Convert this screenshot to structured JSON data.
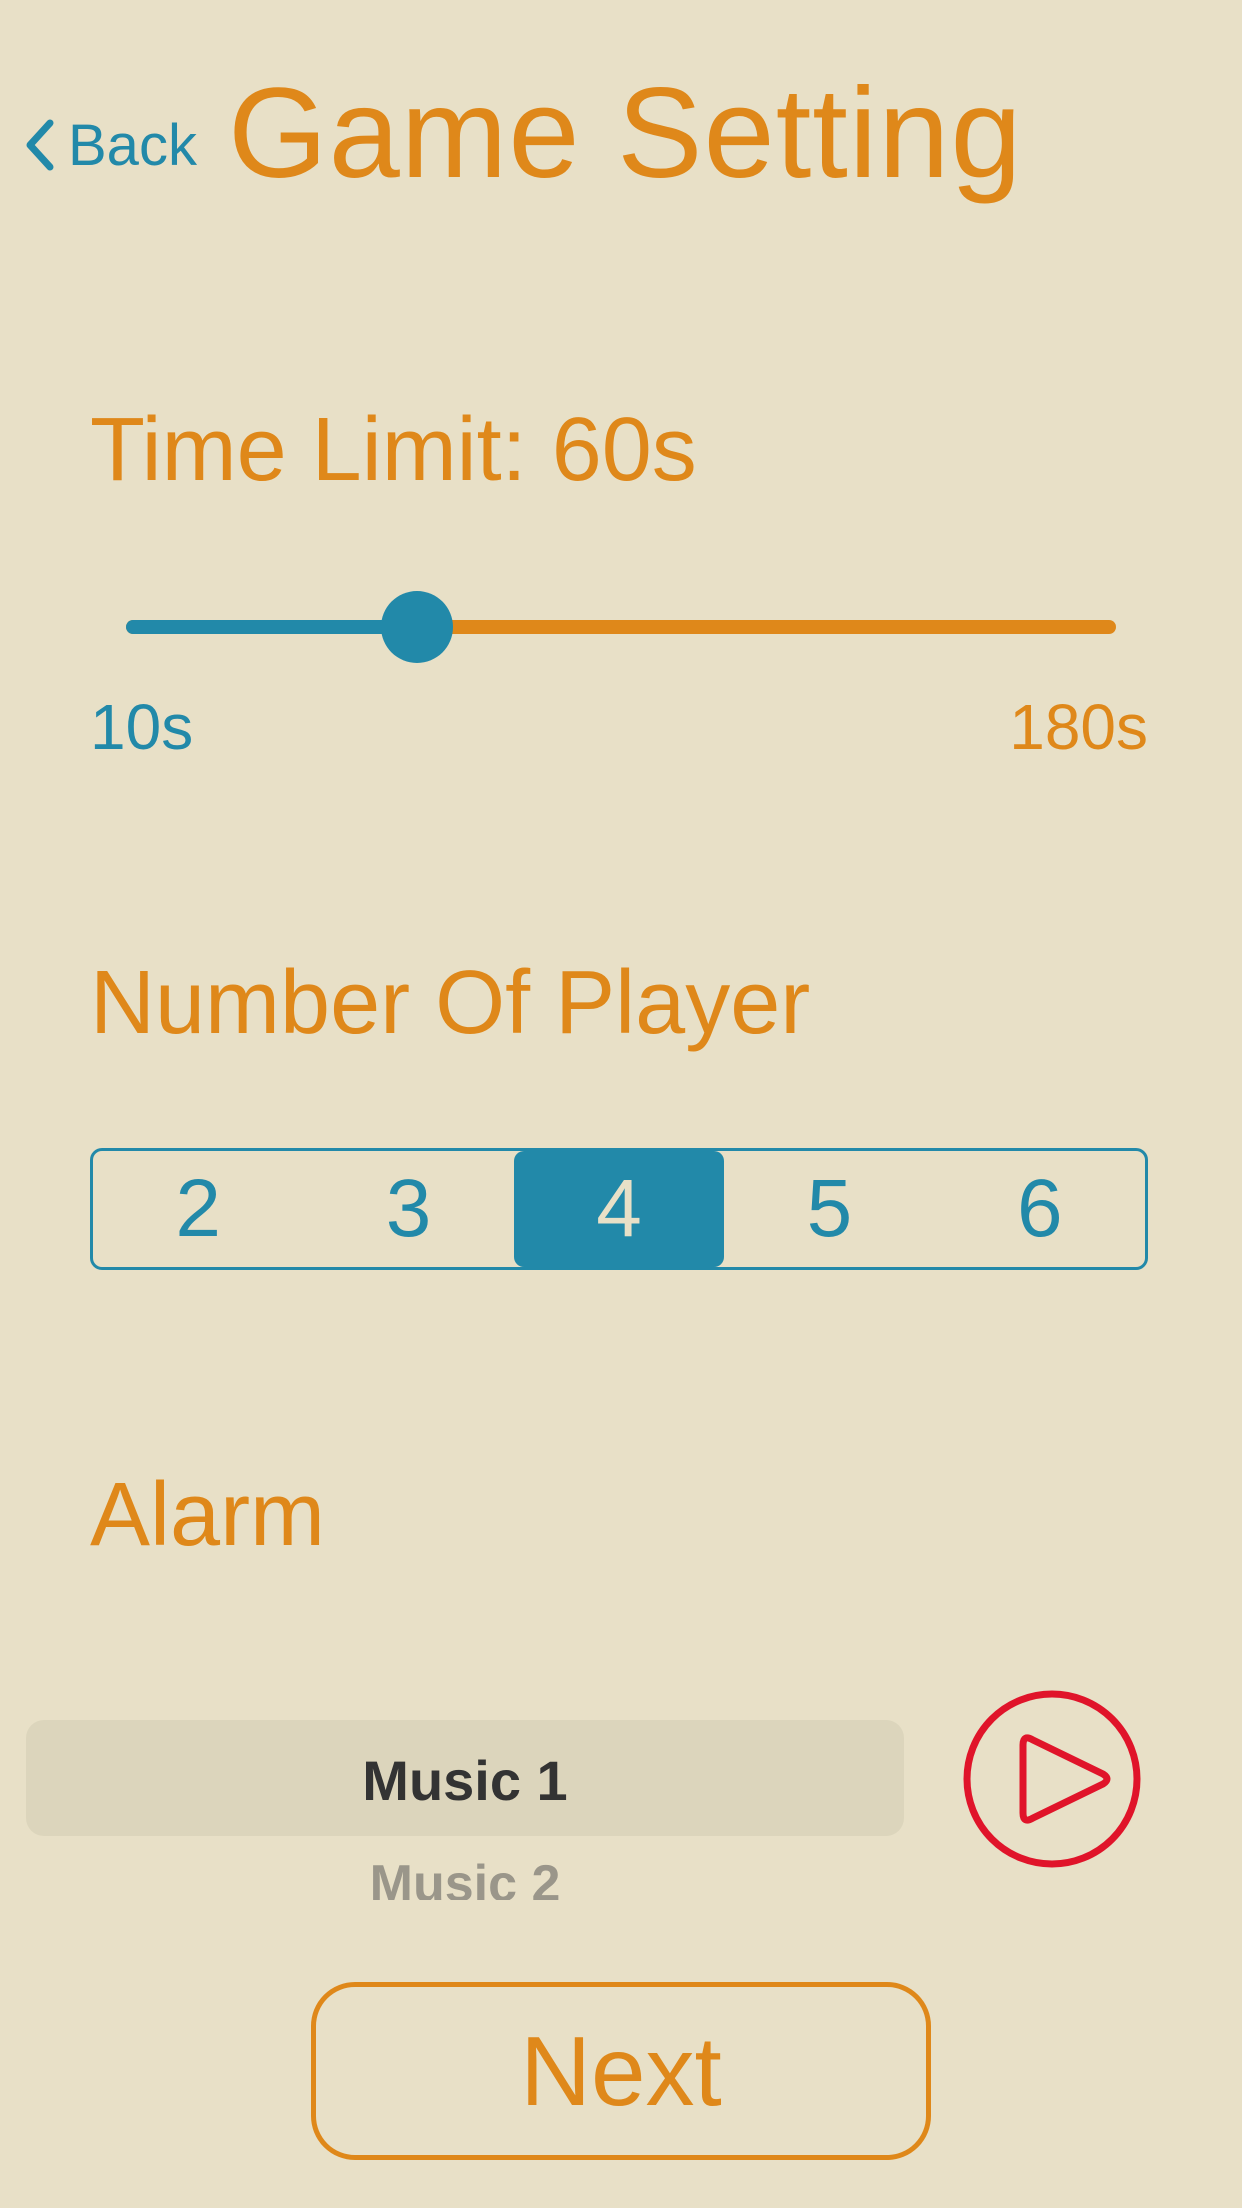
{
  "header": {
    "back_label": "Back",
    "title": "Game Setting"
  },
  "time_limit": {
    "title": "Time Limit: 60s",
    "min_label": "10s",
    "max_label": "180s",
    "value_seconds": 60,
    "min_seconds": 10,
    "max_seconds": 180
  },
  "players": {
    "title": "Number Of Player",
    "options": [
      "2",
      "3",
      "4",
      "5",
      "6"
    ],
    "selected_index": 2
  },
  "alarm": {
    "title": "Alarm",
    "selected_option": "Music 1",
    "next_option": "Music 2",
    "play_icon": "play-icon"
  },
  "next_label": "Next",
  "colors": {
    "background": "#e8e0c7",
    "accent_orange": "#df881a",
    "accent_blue": "#2289a9",
    "play_red": "#e0142a"
  }
}
